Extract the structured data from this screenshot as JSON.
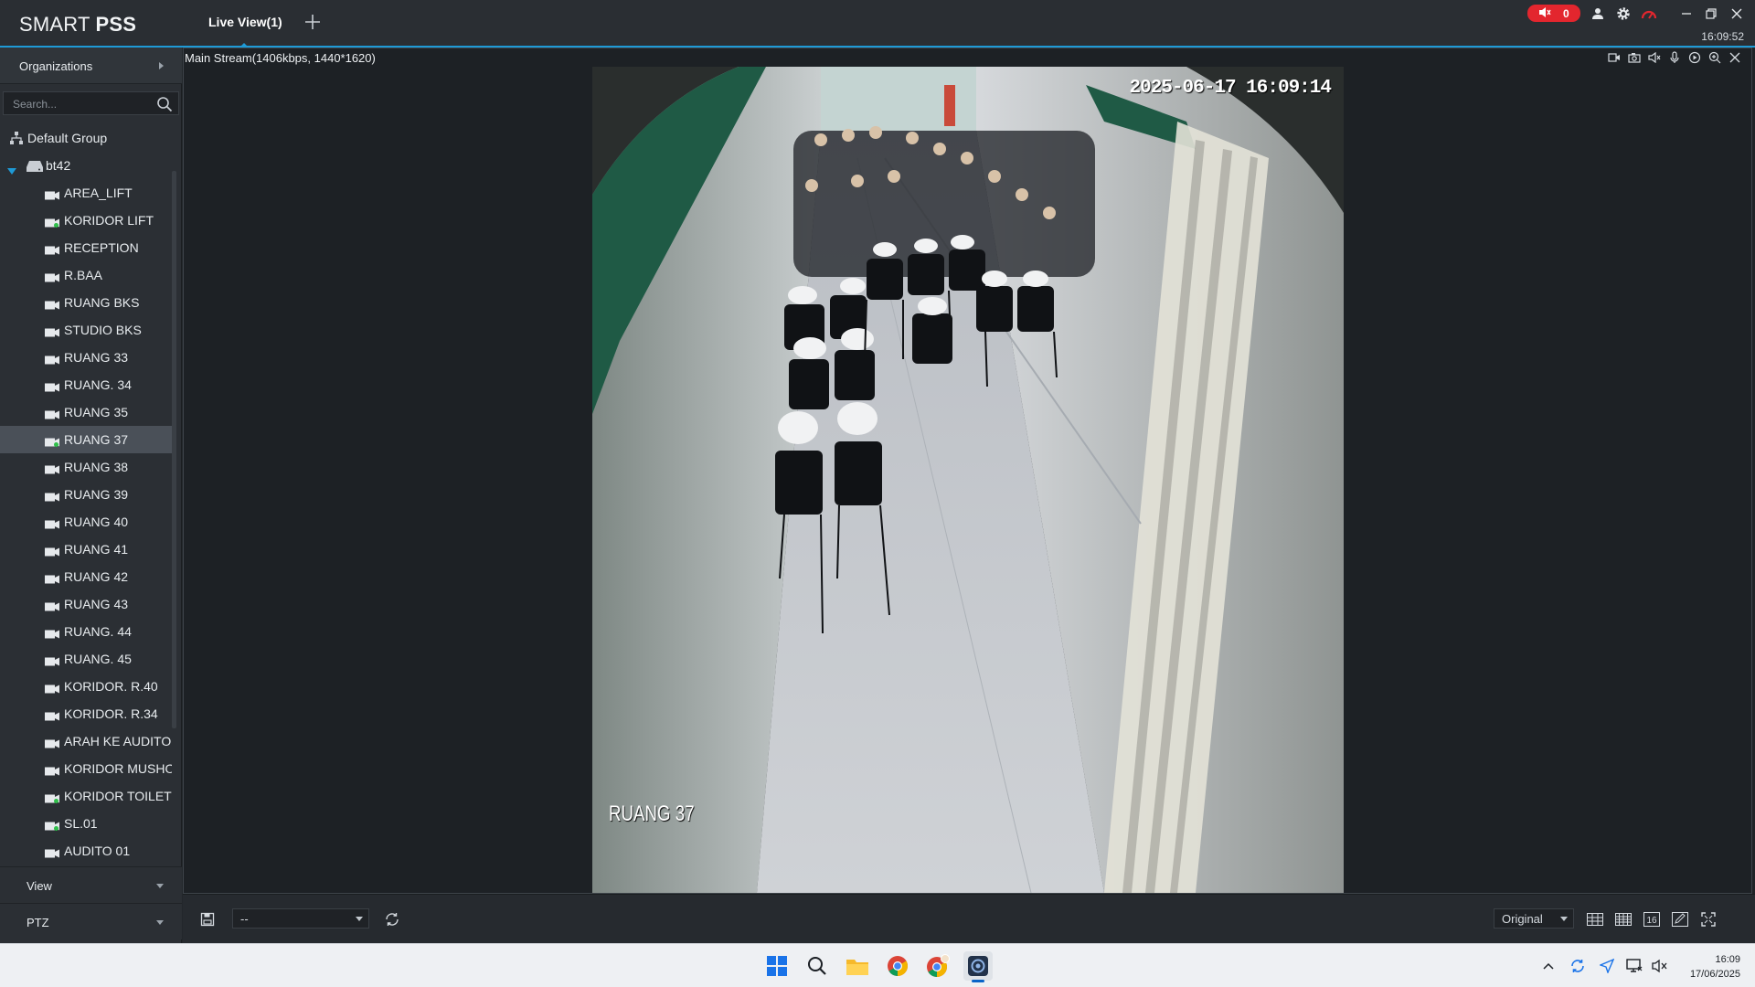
{
  "app": {
    "brand_normal": "SMART ",
    "brand_bold": "PSS",
    "tab_label": "Live View(1)",
    "alarm_count": "0",
    "clock": "16:09:52",
    "colors": {
      "accent": "#1e9ad6",
      "alarm": "#e3262e",
      "online": "#2fbf4a"
    }
  },
  "sidebar": {
    "organizations_label": "Organizations",
    "search_placeholder": "Search...",
    "group": "Default Group",
    "device": "bt42",
    "cameras": [
      {
        "label": "AREA_LIFT",
        "online": false
      },
      {
        "label": "KORIDOR LIFT",
        "online": true
      },
      {
        "label": "RECEPTION",
        "online": false
      },
      {
        "label": "R.BAA",
        "online": false
      },
      {
        "label": "RUANG BKS",
        "online": false
      },
      {
        "label": "STUDIO BKS",
        "online": false
      },
      {
        "label": "RUANG 33",
        "online": false
      },
      {
        "label": "RUANG. 34",
        "online": false
      },
      {
        "label": "RUANG 35",
        "online": false
      },
      {
        "label": "RUANG  37",
        "online": true,
        "selected": true
      },
      {
        "label": "RUANG 38",
        "online": false
      },
      {
        "label": "RUANG 39",
        "online": false
      },
      {
        "label": "RUANG 40",
        "online": false
      },
      {
        "label": "RUANG 41",
        "online": false
      },
      {
        "label": "RUANG 42",
        "online": false
      },
      {
        "label": "RUANG 43",
        "online": false
      },
      {
        "label": "RUANG. 44",
        "online": false
      },
      {
        "label": "RUANG. 45",
        "online": false
      },
      {
        "label": "KORIDOR. R.40",
        "online": false
      },
      {
        "label": "KORIDOR. R.34",
        "online": false
      },
      {
        "label": "ARAH KE AUDITOR",
        "online": false
      },
      {
        "label": "KORIDOR MUSHO",
        "online": false
      },
      {
        "label": "KORIDOR TOILET",
        "online": true
      },
      {
        "label": "SL.01",
        "online": true
      },
      {
        "label": "AUDITO 01",
        "online": false
      }
    ],
    "view_label": "View",
    "ptz_label": "PTZ"
  },
  "pane": {
    "title": "Main Stream(1406kbps, 1440*1620)",
    "osd_timestamp": "2025-06-17 16:09:14",
    "osd_camera": "RUANG 37"
  },
  "bottombar": {
    "preset_value": "--",
    "stream_mode": "Original"
  },
  "taskbar": {
    "time": "16:09",
    "date": "17/06/2025"
  }
}
